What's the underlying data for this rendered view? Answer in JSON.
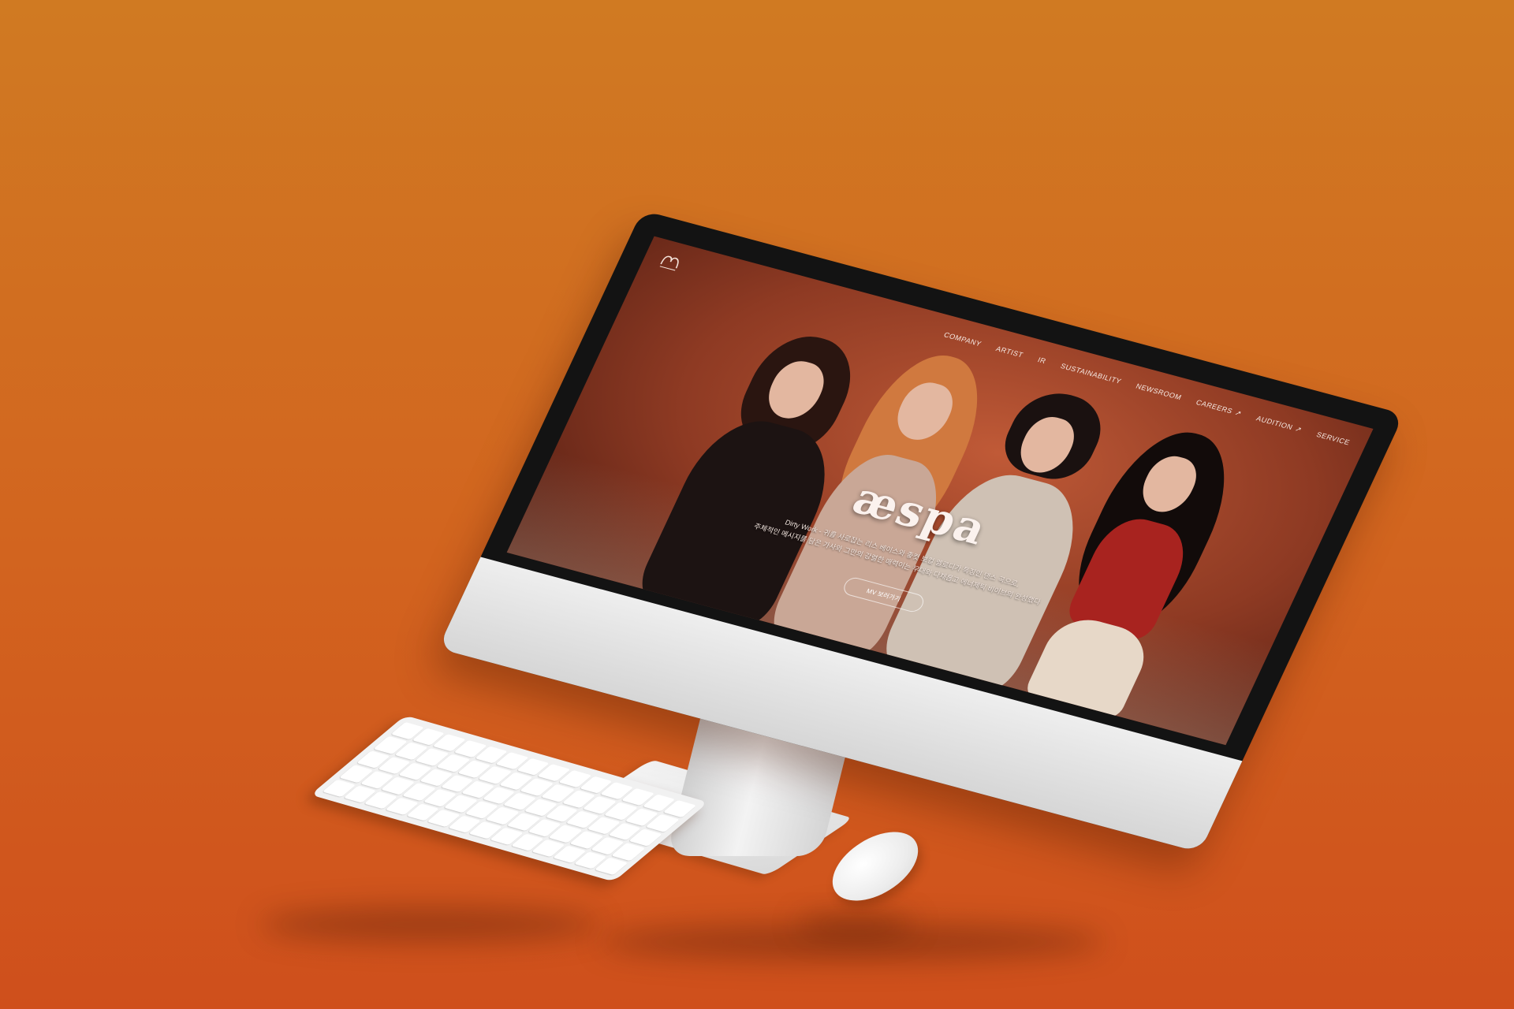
{
  "site": {
    "logo_label": "",
    "nav": [
      {
        "label": "COMPANY",
        "external": false
      },
      {
        "label": "ARTIST",
        "external": false
      },
      {
        "label": "IR",
        "external": false
      },
      {
        "label": "SUSTAINABILITY",
        "external": false
      },
      {
        "label": "NEWSROOM",
        "external": false
      },
      {
        "label": "CAREERS",
        "external": true
      },
      {
        "label": "AUDITION",
        "external": true
      },
      {
        "label": "SERVICE",
        "external": false
      }
    ],
    "external_icon": "↗"
  },
  "hero": {
    "artist_logo": "æspa",
    "description_line1": "Dirty Work - 귀를 사로잡는 리스 베이스와 좋컷 보컬 멜로디가 특징인 댄스 곡으로,",
    "description_line2": "주체적인 메시지를 담은 가사와 그만의 강렬한 매력이는 무대와 다채롭고 에너제틱 비이브의 완성했다",
    "mv_button_label": "MV 보러가기"
  },
  "colors": {
    "background_top": "#d07a22",
    "background_bottom": "#cf4f1c",
    "screen_bg": "#8e3a23",
    "accent_text": "#fbf2ee"
  },
  "icons": {
    "logo": "sm-logo-icon",
    "external_link": "external-link-icon"
  }
}
